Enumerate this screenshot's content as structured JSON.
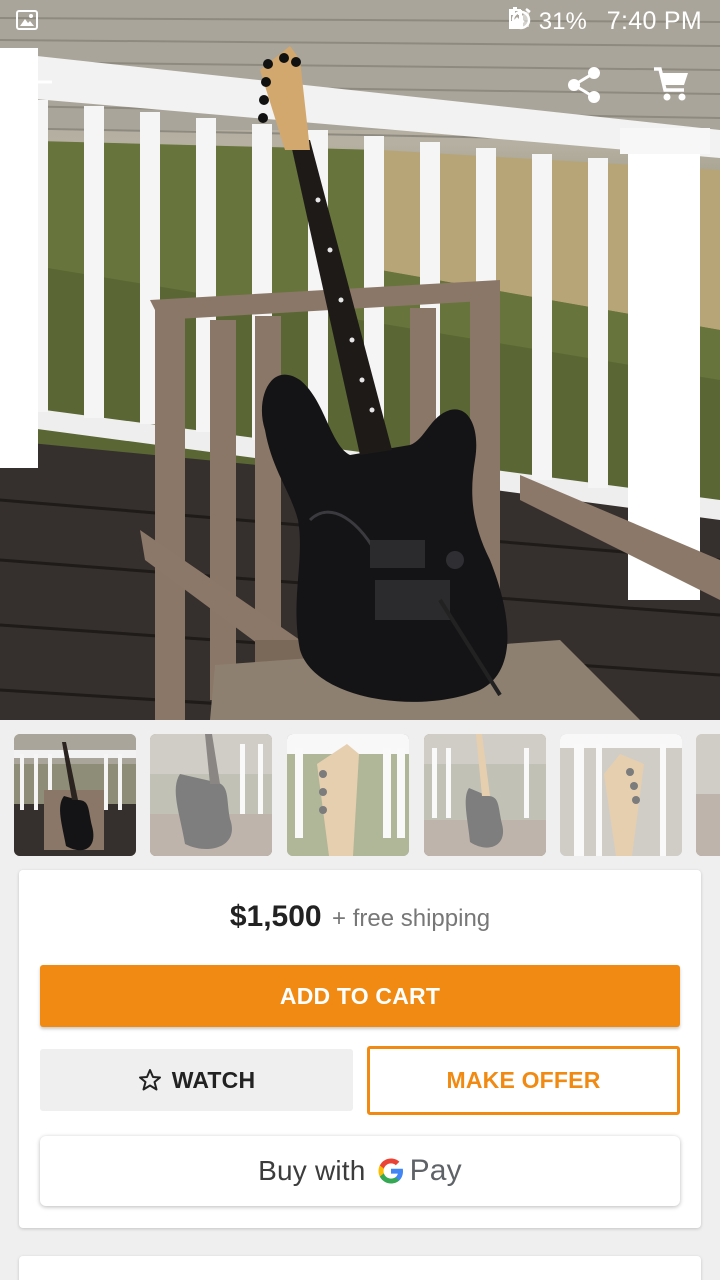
{
  "status_bar": {
    "battery": "31%",
    "time": "7:40 PM"
  },
  "header": {
    "back_icon": "arrow-left-icon",
    "share_icon": "share-icon",
    "cart_icon": "cart-icon"
  },
  "gallery": {
    "thumbnail_count": 6,
    "selected_index": 0
  },
  "listing": {
    "price": "$1,500",
    "shipping": "+ free shipping"
  },
  "actions": {
    "add_to_cart": "ADD TO CART",
    "watch": "WATCH",
    "make_offer": "MAKE OFFER",
    "buy_with": "Buy with",
    "gpay_suffix": "Pay"
  },
  "colors": {
    "accent": "#f18a12",
    "background": "#efefef"
  }
}
